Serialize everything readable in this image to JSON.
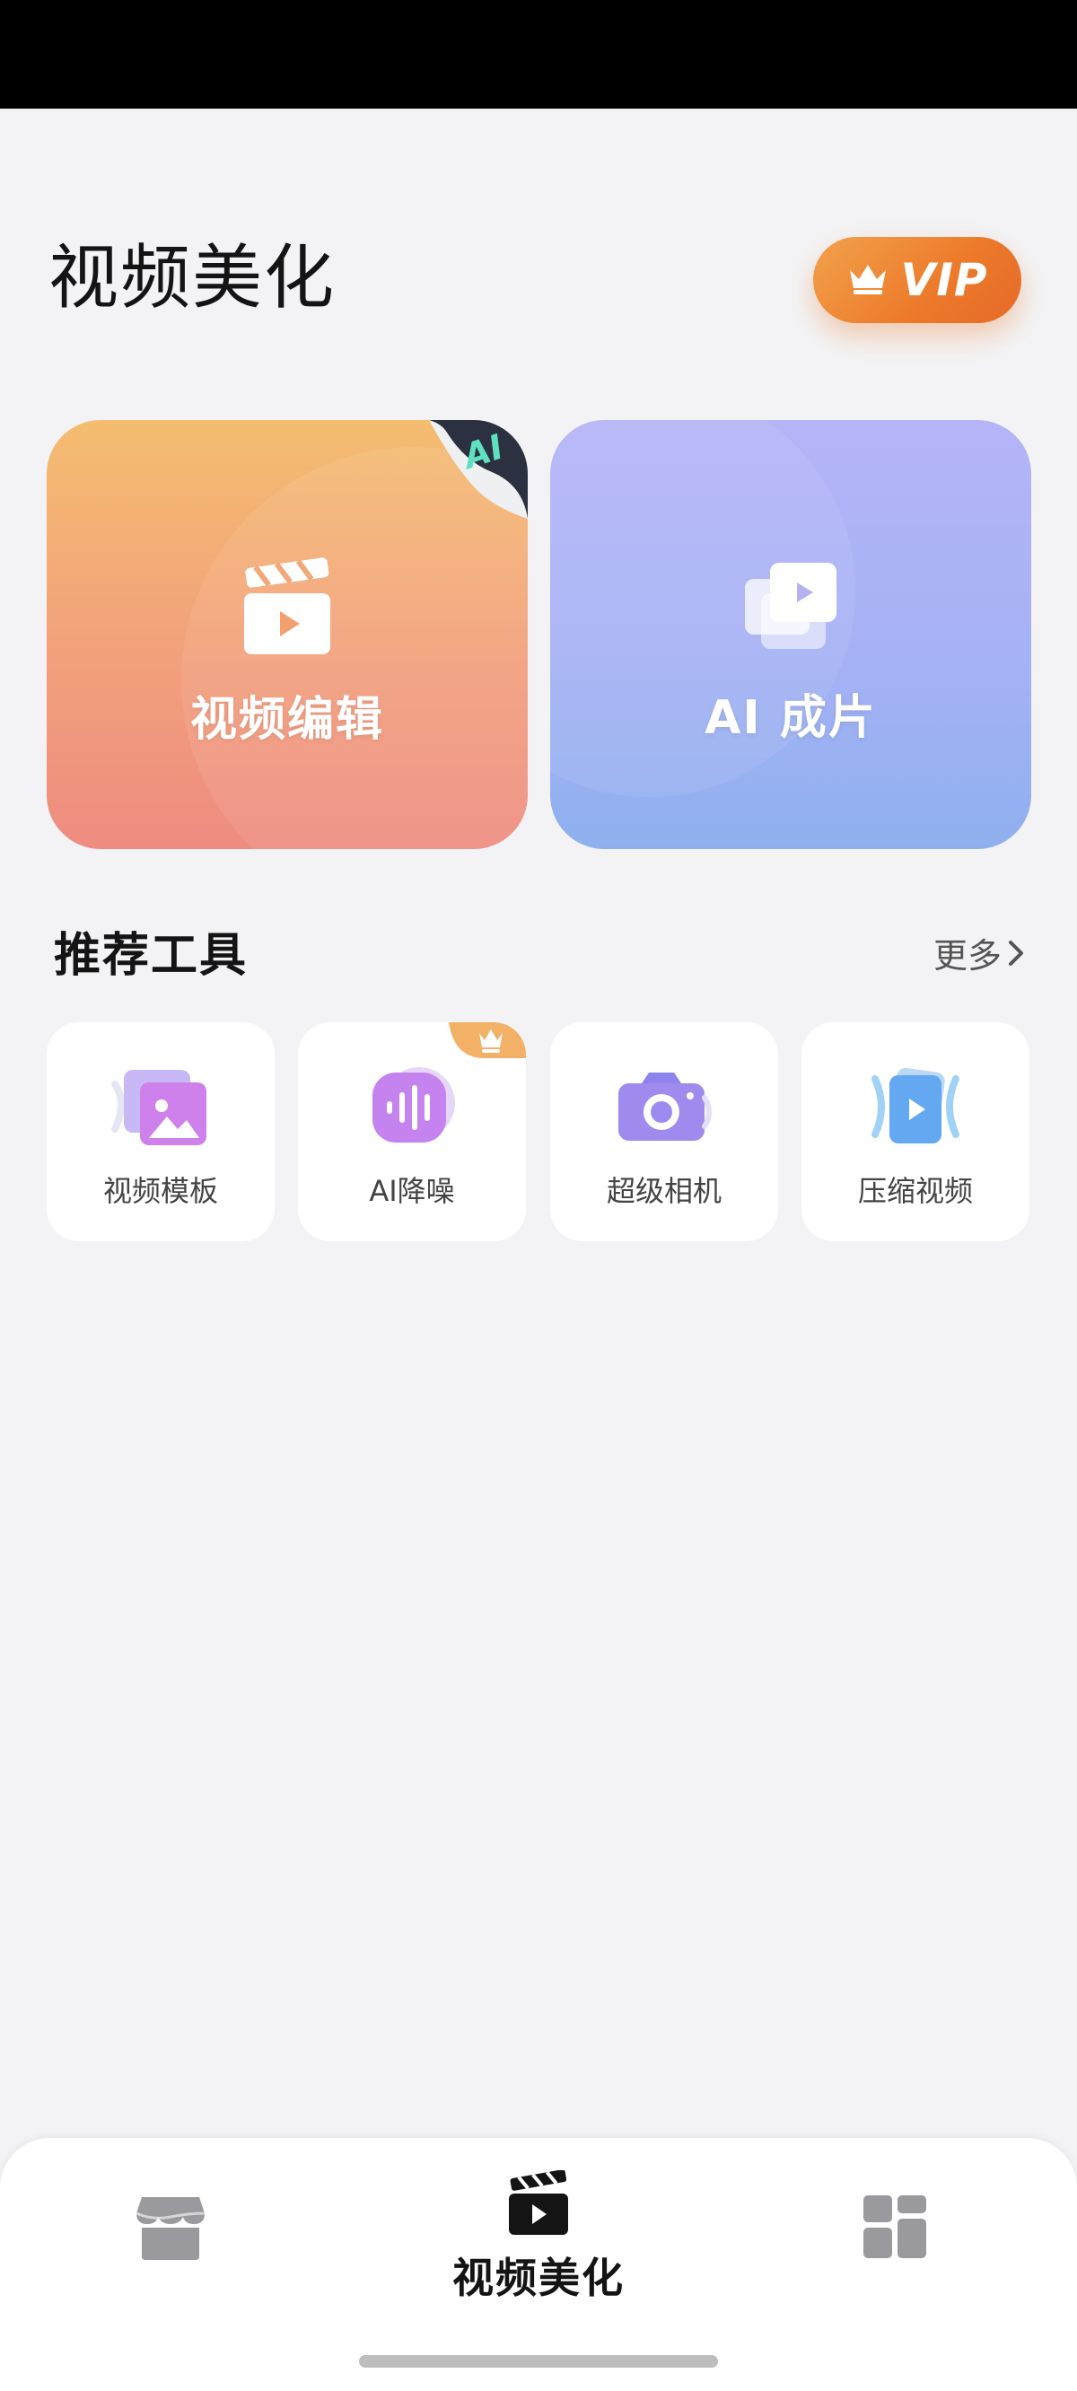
{
  "header": {
    "title": "视频美化",
    "vip_label": "VIP"
  },
  "features": [
    {
      "label": "视频编辑",
      "icon": "clapperboard-icon",
      "badge": "AI"
    },
    {
      "label": "AI 成片",
      "icon": "video-stack-icon"
    }
  ],
  "tools_section": {
    "title": "推荐工具",
    "more_label": "更多"
  },
  "tools": [
    {
      "label": "视频模板",
      "icon": "template-icon"
    },
    {
      "label": "AI降噪",
      "icon": "noise-reduction-icon",
      "vip": true
    },
    {
      "label": "超级相机",
      "icon": "camera-icon"
    },
    {
      "label": "压缩视频",
      "icon": "compress-video-icon"
    }
  ],
  "tab_bar": {
    "tabs": [
      {
        "icon": "store-icon"
      },
      {
        "label": "视频美化",
        "icon": "clapperboard-icon",
        "selected": true
      },
      {
        "icon": "apps-grid-icon"
      }
    ]
  },
  "colors": {
    "vip_orange": "#ec7a2a",
    "edit_card": "#f2a07b",
    "ai_card": "#a8b2f6",
    "background": "#f3f3f5"
  }
}
